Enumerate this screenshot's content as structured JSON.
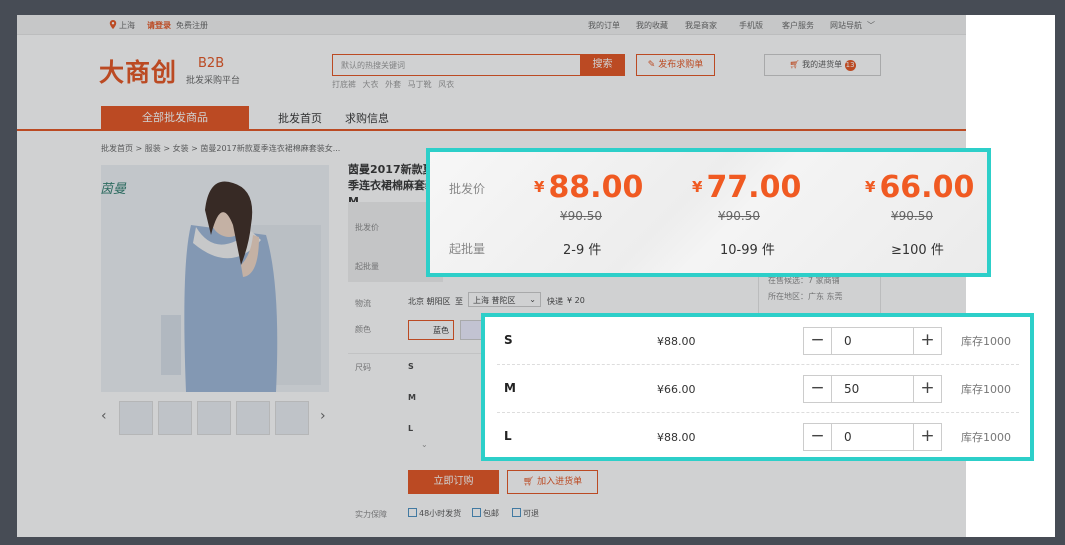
{
  "topbar": {
    "location": "上海",
    "login": "请登录",
    "register": "免费注册",
    "links": [
      "我的订单",
      "我的收藏",
      "我是商家",
      "手机版",
      "客户服务",
      "网站导航"
    ]
  },
  "header": {
    "logo": "大商创",
    "b2b": "B2B",
    "subtitle": "批发采购平台",
    "search_placeholder": "默认的热搜关键词",
    "search_button": "搜索",
    "hot_words": [
      "打底裤",
      "大衣",
      "外套",
      "马丁靴",
      "风衣"
    ],
    "publish_button": "发布求购单",
    "cart_label": "我的进货单",
    "cart_count": "13"
  },
  "nav": {
    "all": "全部批发商品",
    "items": [
      "批发首页",
      "求购信息"
    ]
  },
  "breadcrumb": "批发首页 > 服装 > 女装 > 茵曼2017新款夏季连衣裙棉麻套装女...",
  "product": {
    "brand": "茵曼",
    "title": "茵曼2017新款夏季连衣裙棉麻套装 M",
    "price_label": "批发价",
    "moq_label": "起批量",
    "logistics_label": "物流",
    "from": "北京 朝阳区",
    "to_label": "至",
    "to": "上海 普陀区",
    "express": "快递",
    "express_price": "¥ 20",
    "color_label": "颜色",
    "color_value": "蓝色",
    "size_label": "尺码",
    "sizes_behind": [
      "S",
      "M",
      "L"
    ],
    "buy_button": "立即订购",
    "add_cart_button": "加入进货单",
    "guarantee_label": "实力保障",
    "guarantees": [
      "48小时发货",
      "包邮",
      "可退"
    ]
  },
  "seller": {
    "line1": "在售候选：7 家商铺",
    "line2": "所在地区：广东 东莞"
  },
  "tier_overlay": {
    "price_label": "批发价",
    "moq_label": "起批量",
    "currency": "¥",
    "tiers": [
      {
        "price": "88.00",
        "old": "¥90.50",
        "qty": "2-9 件"
      },
      {
        "price": "77.00",
        "old": "¥90.50",
        "qty": "10-99 件"
      },
      {
        "price": "66.00",
        "old": "¥90.50",
        "qty": "≥100 件"
      }
    ]
  },
  "size_overlay": {
    "rows": [
      {
        "size": "S",
        "price": "¥88.00",
        "qty": "0",
        "stock": "库存1000"
      },
      {
        "size": "M",
        "price": "¥66.00",
        "qty": "50",
        "stock": "库存1000"
      },
      {
        "size": "L",
        "price": "¥88.00",
        "qty": "0",
        "stock": "库存1000"
      }
    ],
    "minus": "−",
    "plus": "+"
  }
}
